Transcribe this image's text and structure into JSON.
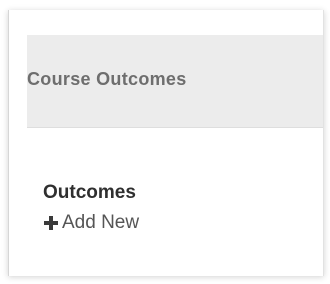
{
  "header": {
    "title": "Course Outcomes"
  },
  "section": {
    "title": "Outcomes",
    "add_new_label": "Add New",
    "add_new_icon": "plus-icon"
  },
  "colors": {
    "header_background": "#ececec",
    "header_text": "#6e6e6e",
    "section_title": "#2f2f2f",
    "add_new_text": "#555555"
  }
}
